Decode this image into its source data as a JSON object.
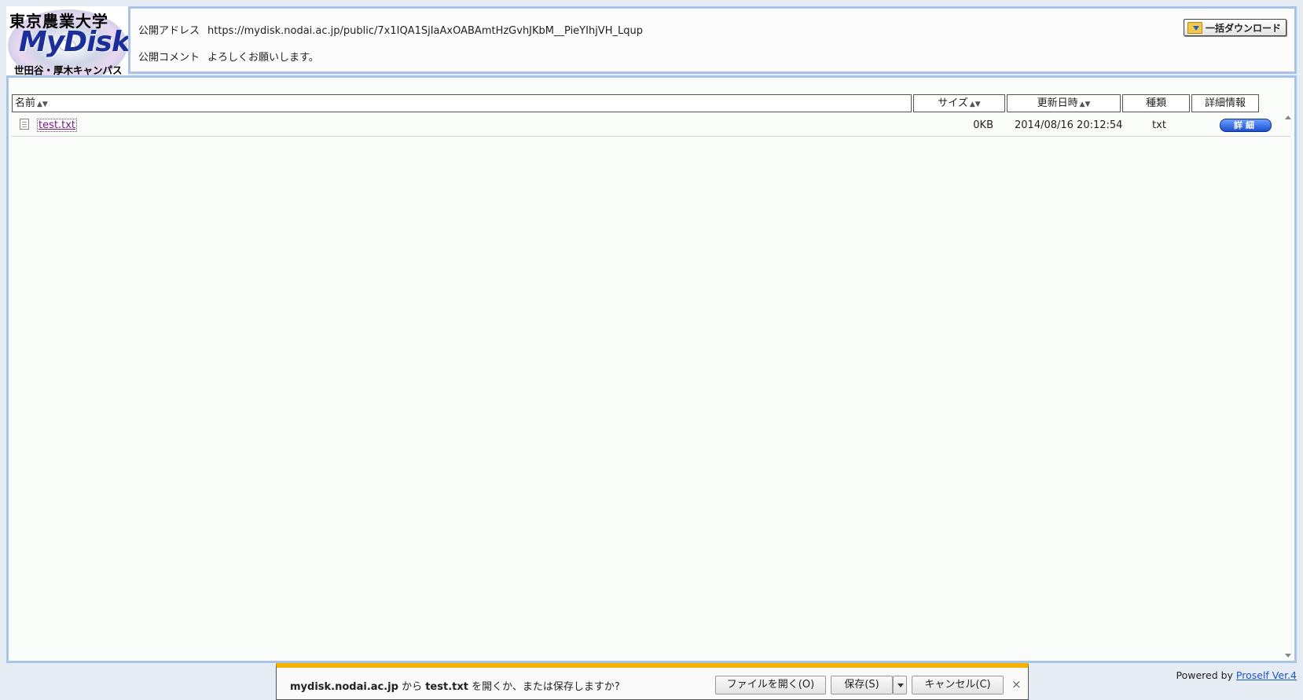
{
  "logo": {
    "title_jp": "東京農業大学",
    "brand": "MyDisk",
    "campus": "世田谷・厚木キャンパス"
  },
  "info": {
    "address_label": "公開アドレス",
    "address_value": "https://mydisk.nodai.ac.jp/public/7x1IQA1SjIaAxOABAmtHzGvhJKbM__PieYIhjVH_Lqup",
    "comment_label": "公開コメント",
    "comment_value": "よろしくお願いします。",
    "bulk_download_label": "一括ダウンロード"
  },
  "table": {
    "columns": {
      "name": "名前",
      "size": "サイズ",
      "updated": "更新日時",
      "type": "種類",
      "details": "詳細情報"
    },
    "sort_arrows": "▲▼",
    "rows": [
      {
        "name": "test.txt",
        "size": "0KB",
        "updated": "2014/08/16 20:12:54",
        "type": "txt",
        "detail_button": "詳細"
      }
    ]
  },
  "footer": {
    "powered_text": "Powered by ",
    "powered_link": "Proself Ver.4"
  },
  "download_bar": {
    "host": "mydisk.nodai.ac.jp",
    "from": " から ",
    "file": "test.txt",
    "question": " を開くか、または保存しますか?",
    "open_label": "ファイルを開く(O)",
    "save_label": "保存(S)",
    "cancel_label": "キャンセル(C)",
    "close_glyph": "×"
  },
  "colors": {
    "panel_border": "#a9c4e6",
    "link_visited": "#7a1a8a",
    "link": "#1a55c8",
    "notification_accent": "#f3b200",
    "detail_button": "#1a4fd1"
  }
}
